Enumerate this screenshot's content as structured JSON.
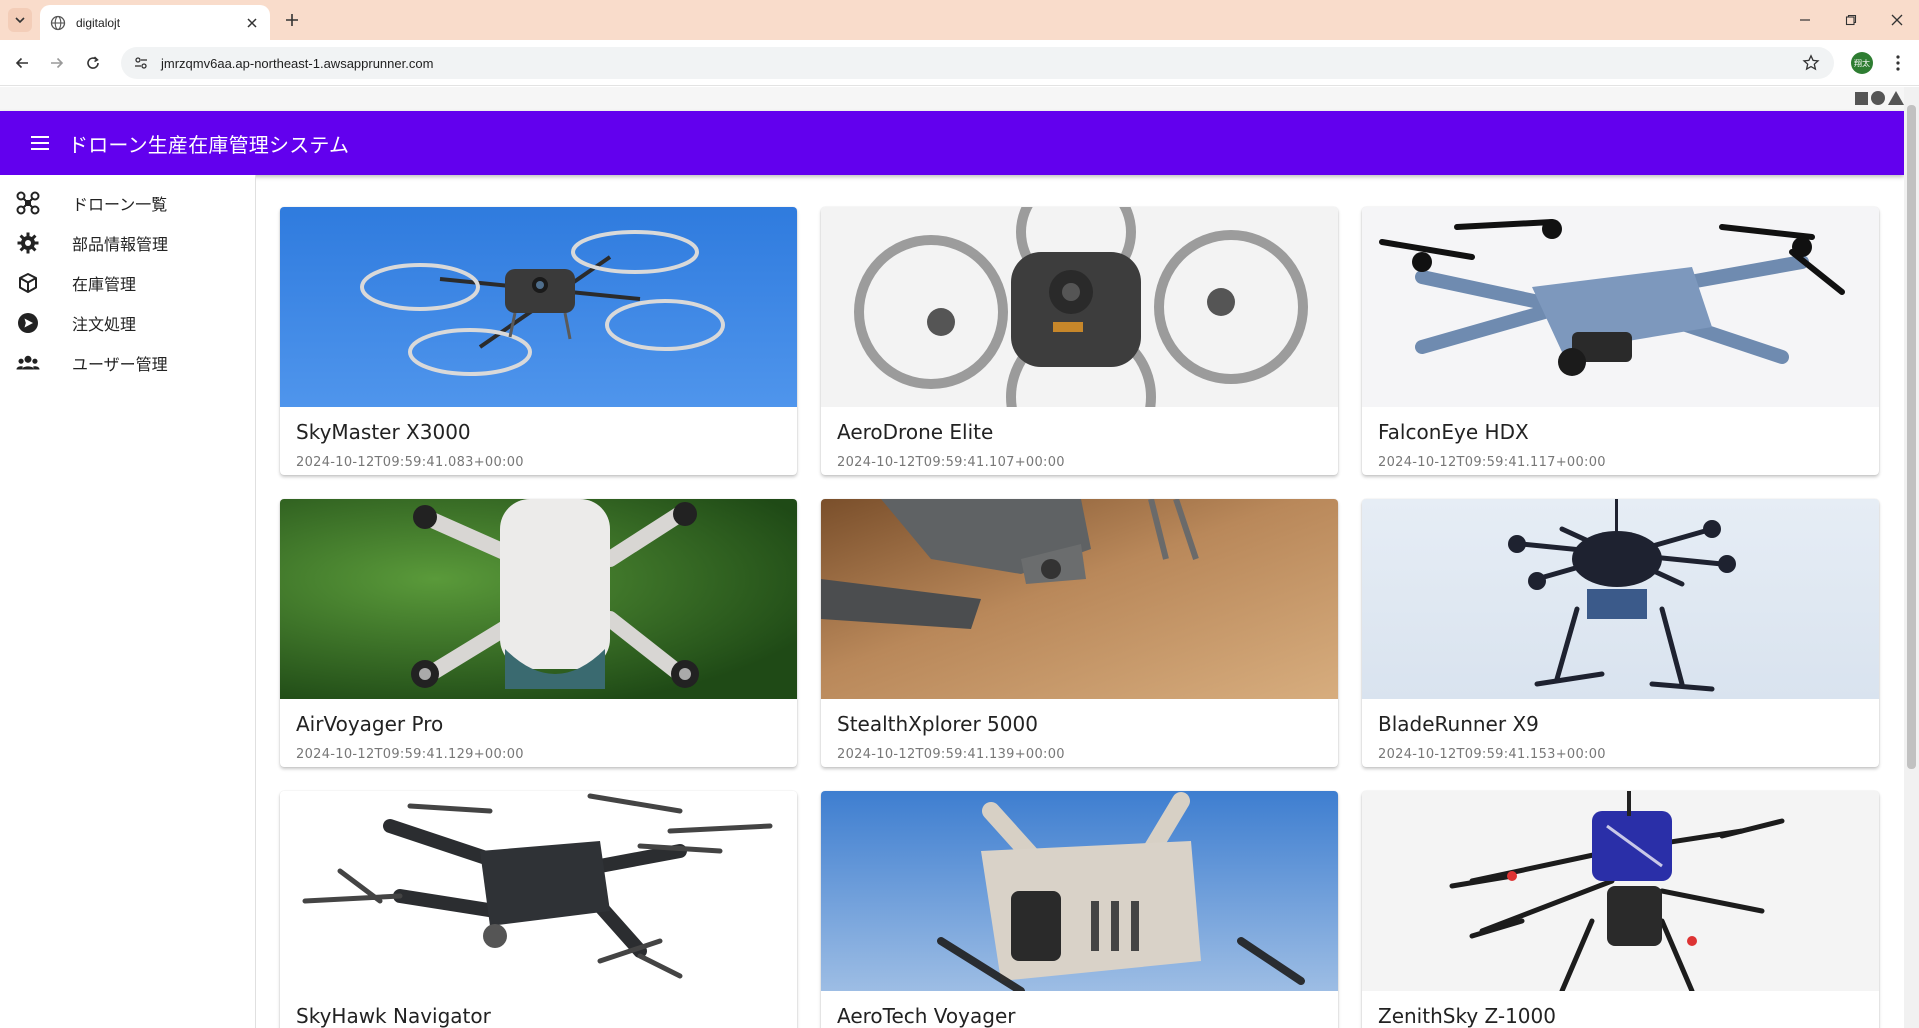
{
  "browser": {
    "tab_title": "digitalojt",
    "url": "jmrzqmv6aa.ap-northeast-1.awsapprunner.com",
    "avatar_label": "翔太",
    "tabstrip_color": "#f9dccb"
  },
  "app": {
    "title": "ドローン生産在庫管理システム",
    "appbar_color": "#6200ee"
  },
  "nav": {
    "items": [
      {
        "label": "ドローン一覧",
        "icon": "drone-icon"
      },
      {
        "label": "部品情報管理",
        "icon": "gear-icon"
      },
      {
        "label": "在庫管理",
        "icon": "box-icon"
      },
      {
        "label": "注文処理",
        "icon": "send-icon"
      },
      {
        "label": "ユーザー管理",
        "icon": "users-icon"
      }
    ]
  },
  "drones": [
    {
      "name": "SkyMaster X3000",
      "date": "2024-10-12T09:59:41.083+00:00",
      "bg": "#3b86e6",
      "body": "#3a3a3a"
    },
    {
      "name": "AeroDrone Elite",
      "date": "2024-10-12T09:59:41.107+00:00",
      "bg": "#f2f2f2",
      "body": "#4a4a4a"
    },
    {
      "name": "FalconEye HDX",
      "date": "2024-10-12T09:59:41.117+00:00",
      "bg": "#f4f4f6",
      "body": "#6f8bb0"
    },
    {
      "name": "AirVoyager Pro",
      "date": "2024-10-12T09:59:41.129+00:00",
      "bg": "#3f7a2c",
      "body": "#e8e6e4"
    },
    {
      "name": "StealthXplorer 5000",
      "date": "2024-10-12T09:59:41.139+00:00",
      "bg": "#b07b4c",
      "body": "#5d5f60"
    },
    {
      "name": "BladeRunner X9",
      "date": "2024-10-12T09:59:41.153+00:00",
      "bg": "#e4ecf4",
      "body": "#1e2230"
    },
    {
      "name": "SkyHawk Navigator",
      "date": "",
      "bg": "#ffffff",
      "body": "#2b2d30"
    },
    {
      "name": "AeroTech Voyager",
      "date": "",
      "bg": "#4a86cf",
      "body": "#d9d2c8"
    },
    {
      "name": "ZenithSky Z-1000",
      "date": "",
      "bg": "#f5f5f5",
      "body": "#2a2fa8"
    }
  ]
}
